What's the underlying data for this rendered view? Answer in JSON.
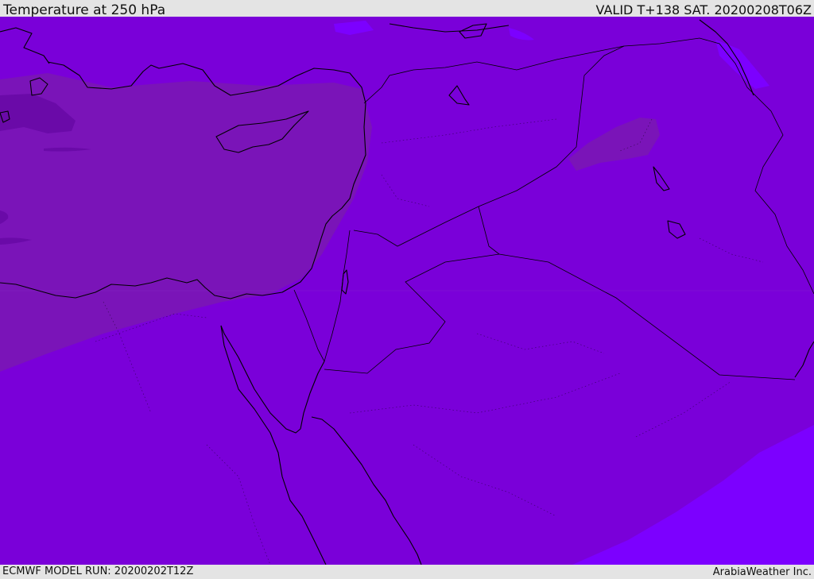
{
  "header": {
    "title": "Temperature at 250 hPa",
    "valid": "VALID T+138 SAT. 20200208T06Z"
  },
  "footer": {
    "model_run": "ECMWF MODEL RUN: 20200202T12Z",
    "credit": "ArabiaWeather Inc."
  },
  "colors": {
    "background": "#7a00d9",
    "cold_band": "#7a14b8",
    "coldest_core": "#6a0aa8",
    "warm_band": "#7c00ff",
    "coastline": "#000000",
    "frame": "#e4e4e4"
  }
}
